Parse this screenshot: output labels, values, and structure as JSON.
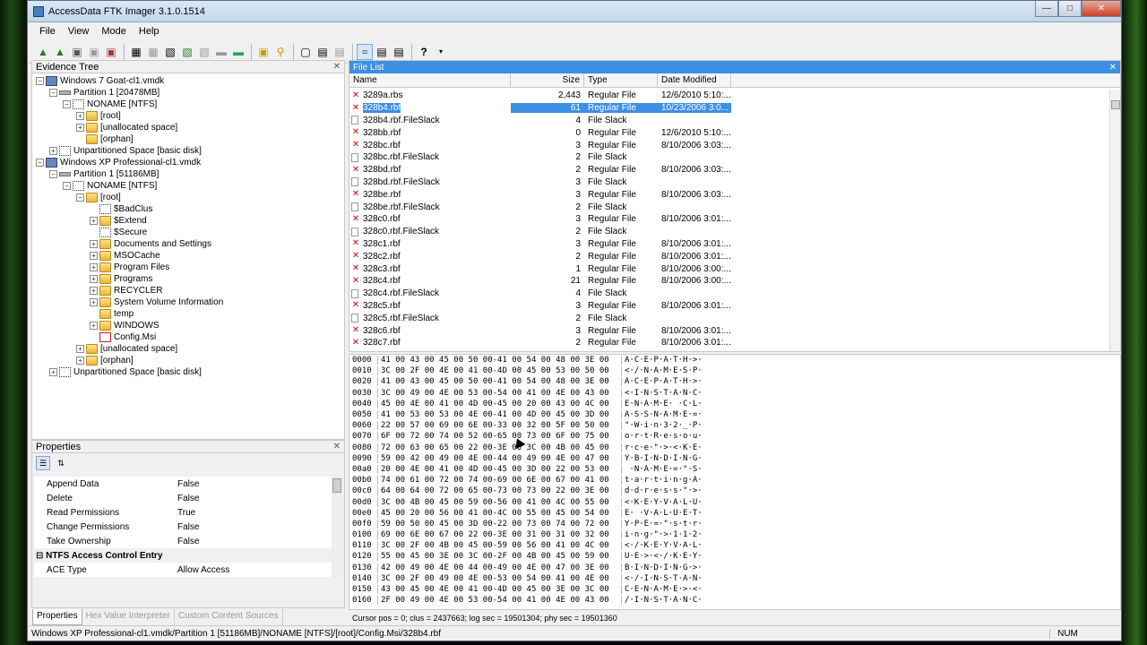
{
  "window": {
    "title": "AccessData FTK Imager 3.1.0.1514"
  },
  "menu": [
    "File",
    "View",
    "Mode",
    "Help"
  ],
  "evidence_tree": {
    "title": "Evidence Tree",
    "nodes": [
      {
        "label": "Windows 7 Goat-cl1.vmdk",
        "indent": 0,
        "icon": "disk",
        "pm": "-"
      },
      {
        "label": "Partition 1 [20478MB]",
        "indent": 1,
        "icon": "part",
        "pm": "-"
      },
      {
        "label": "NONAME [NTFS]",
        "indent": 2,
        "icon": "fs",
        "pm": "-"
      },
      {
        "label": "[root]",
        "indent": 3,
        "icon": "folder",
        "pm": "+"
      },
      {
        "label": "[unallocated space]",
        "indent": 3,
        "icon": "folder",
        "pm": "+"
      },
      {
        "label": "[orphan]",
        "indent": 3,
        "icon": "folder",
        "pm": ""
      },
      {
        "label": "Unpartitioned Space [basic disk]",
        "indent": 1,
        "icon": "fs",
        "pm": "+"
      },
      {
        "label": "Windows XP Professional-cl1.vmdk",
        "indent": 0,
        "icon": "disk",
        "pm": "-"
      },
      {
        "label": "Partition 1 [51186MB]",
        "indent": 1,
        "icon": "part",
        "pm": "-"
      },
      {
        "label": "NONAME [NTFS]",
        "indent": 2,
        "icon": "fs",
        "pm": "-"
      },
      {
        "label": "[root]",
        "indent": 3,
        "icon": "folder",
        "pm": "-"
      },
      {
        "label": "$BadClus",
        "indent": 4,
        "icon": "fs",
        "pm": ""
      },
      {
        "label": "$Extend",
        "indent": 4,
        "icon": "folder",
        "pm": "+"
      },
      {
        "label": "$Secure",
        "indent": 4,
        "icon": "fs",
        "pm": ""
      },
      {
        "label": "Documents and Settings",
        "indent": 4,
        "icon": "folder",
        "pm": "+"
      },
      {
        "label": "MSOCache",
        "indent": 4,
        "icon": "folder",
        "pm": "+"
      },
      {
        "label": "Program Files",
        "indent": 4,
        "icon": "folder",
        "pm": "+"
      },
      {
        "label": "Programs",
        "indent": 4,
        "icon": "folder",
        "pm": "+"
      },
      {
        "label": "RECYCLER",
        "indent": 4,
        "icon": "folder",
        "pm": "+"
      },
      {
        "label": "System Volume Information",
        "indent": 4,
        "icon": "folder",
        "pm": "+"
      },
      {
        "label": "temp",
        "indent": 4,
        "icon": "folder",
        "pm": ""
      },
      {
        "label": "WINDOWS",
        "indent": 4,
        "icon": "folder",
        "pm": "+"
      },
      {
        "label": "Config.Msi",
        "indent": 4,
        "icon": "del",
        "pm": ""
      },
      {
        "label": "[unallocated space]",
        "indent": 3,
        "icon": "folder",
        "pm": "+"
      },
      {
        "label": "[orphan]",
        "indent": 3,
        "icon": "folder",
        "pm": "+"
      },
      {
        "label": "Unpartitioned Space [basic disk]",
        "indent": 1,
        "icon": "fs",
        "pm": "+"
      }
    ]
  },
  "properties": {
    "title": "Properties",
    "rows": [
      {
        "k": "Append Data",
        "v": "False"
      },
      {
        "k": "Delete",
        "v": "False"
      },
      {
        "k": "Read Permissions",
        "v": "True"
      },
      {
        "k": "Change Permissions",
        "v": "False"
      },
      {
        "k": "Take Ownership",
        "v": "False"
      },
      {
        "k": "NTFS Access Control Entry",
        "v": "",
        "cat": true
      },
      {
        "k": "ACE Type",
        "v": "Allow Access"
      }
    ],
    "tabs": [
      "Properties",
      "Hex Value Interpreter",
      "Custom Content Sources"
    ]
  },
  "file_list": {
    "title": "File List",
    "columns": [
      "Name",
      "Size",
      "Type",
      "Date Modified"
    ],
    "rows": [
      {
        "name": "3289a.rbs",
        "size": "2,443",
        "type": "Regular File",
        "date": "12/6/2010 5:10:...",
        "icon": "x"
      },
      {
        "name": "328b4.rbf",
        "size": "61",
        "type": "Regular File",
        "date": "10/23/2006 3:0...",
        "icon": "x",
        "sel": true
      },
      {
        "name": "328b4.rbf.FileSlack",
        "size": "4",
        "type": "File Slack",
        "date": "",
        "icon": "slack"
      },
      {
        "name": "328bb.rbf",
        "size": "0",
        "type": "Regular File",
        "date": "12/6/2010 5:10:...",
        "icon": "x"
      },
      {
        "name": "328bc.rbf",
        "size": "3",
        "type": "Regular File",
        "date": "8/10/2006 3:03:...",
        "icon": "x"
      },
      {
        "name": "328bc.rbf.FileSlack",
        "size": "2",
        "type": "File Slack",
        "date": "",
        "icon": "slack"
      },
      {
        "name": "328bd.rbf",
        "size": "2",
        "type": "Regular File",
        "date": "8/10/2006 3:03:...",
        "icon": "x"
      },
      {
        "name": "328bd.rbf.FileSlack",
        "size": "3",
        "type": "File Slack",
        "date": "",
        "icon": "slack"
      },
      {
        "name": "328be.rbf",
        "size": "3",
        "type": "Regular File",
        "date": "8/10/2006 3:03:...",
        "icon": "x"
      },
      {
        "name": "328be.rbf.FileSlack",
        "size": "2",
        "type": "File Slack",
        "date": "",
        "icon": "slack"
      },
      {
        "name": "328c0.rbf",
        "size": "3",
        "type": "Regular File",
        "date": "8/10/2006 3:01:...",
        "icon": "x"
      },
      {
        "name": "328c0.rbf.FileSlack",
        "size": "2",
        "type": "File Slack",
        "date": "",
        "icon": "slack"
      },
      {
        "name": "328c1.rbf",
        "size": "3",
        "type": "Regular File",
        "date": "8/10/2006 3:01:...",
        "icon": "x"
      },
      {
        "name": "328c2.rbf",
        "size": "2",
        "type": "Regular File",
        "date": "8/10/2006 3:01:...",
        "icon": "x"
      },
      {
        "name": "328c3.rbf",
        "size": "1",
        "type": "Regular File",
        "date": "8/10/2006 3:00:...",
        "icon": "x"
      },
      {
        "name": "328c4.rbf",
        "size": "21",
        "type": "Regular File",
        "date": "8/10/2006 3:00:...",
        "icon": "x"
      },
      {
        "name": "328c4.rbf.FileSlack",
        "size": "4",
        "type": "File Slack",
        "date": "",
        "icon": "slack"
      },
      {
        "name": "328c5.rbf",
        "size": "3",
        "type": "Regular File",
        "date": "8/10/2006 3:01:...",
        "icon": "x"
      },
      {
        "name": "328c5.rbf.FileSlack",
        "size": "2",
        "type": "File Slack",
        "date": "",
        "icon": "slack"
      },
      {
        "name": "328c6.rbf",
        "size": "3",
        "type": "Regular File",
        "date": "8/10/2006 3:01:...",
        "icon": "x"
      },
      {
        "name": "328c7.rbf",
        "size": "2",
        "type": "Regular File",
        "date": "8/10/2006 3:01:...",
        "icon": "x"
      }
    ]
  },
  "hex": {
    "rows": [
      {
        "off": "0000",
        "bytes": "41 00 43 00 45 00 50 00-41 00 54 00 48 00 3E 00",
        "text": "A·C·E·P·A·T·H·>·"
      },
      {
        "off": "0010",
        "bytes": "3C 00 2F 00 4E 00 41 00-4D 00 45 00 53 00 50 00",
        "text": "<·/·N·A·M·E·S·P·"
      },
      {
        "off": "0020",
        "bytes": "41 00 43 00 45 00 50 00-41 00 54 00 48 00 3E 00",
        "text": "A·C·E·P·A·T·H·>·"
      },
      {
        "off": "0030",
        "bytes": "3C 00 49 00 4E 00 53 00-54 00 41 00 4E 00 43 00",
        "text": "<·I·N·S·T·A·N·C·"
      },
      {
        "off": "0040",
        "bytes": "45 00 4E 00 41 00 4D 00-45 00 20 00 43 00 4C 00",
        "text": "E·N·A·M·E· ·C·L·"
      },
      {
        "off": "0050",
        "bytes": "41 00 53 00 53 00 4E 00-41 00 4D 00 45 00 3D 00",
        "text": "A·S·S·N·A·M·E·=·"
      },
      {
        "off": "0060",
        "bytes": "22 00 57 00 69 00 6E 00-33 00 32 00 5F 00 50 00",
        "text": "\"·W·i·n·3·2·_·P·"
      },
      {
        "off": "0070",
        "bytes": "6F 00 72 00 74 00 52 00-65 00 73 00 6F 00 75 00",
        "text": "o·r·t·R·e·s·o·u·"
      },
      {
        "off": "0080",
        "bytes": "72 00 63 00 65 00 22 00-3E 00 3C 00 4B 00 45 00",
        "text": "r·c·e·\"·>·<·K·E·"
      },
      {
        "off": "0090",
        "bytes": "59 00 42 00 49 00 4E 00-44 00 49 00 4E 00 47 00",
        "text": "Y·B·I·N·D·I·N·G·"
      },
      {
        "off": "00a0",
        "bytes": "20 00 4E 00 41 00 4D 00-45 00 3D 00 22 00 53 00",
        "text": " ·N·A·M·E·=·\"·S·"
      },
      {
        "off": "00b0",
        "bytes": "74 00 61 00 72 00 74 00-69 00 6E 00 67 00 41 00",
        "text": "t·a·r·t·i·n·g·A·"
      },
      {
        "off": "00c0",
        "bytes": "64 00 64 00 72 00 65 00-73 00 73 00 22 00 3E 00",
        "text": "d·d·r·e·s·s·\"·>·"
      },
      {
        "off": "00d0",
        "bytes": "3C 00 4B 00 45 00 59 00-56 00 41 00 4C 00 55 00",
        "text": "<·K·E·Y·V·A·L·U·"
      },
      {
        "off": "00e0",
        "bytes": "45 00 20 00 56 00 41 00-4C 00 55 00 45 00 54 00",
        "text": "E· ·V·A·L·U·E·T·"
      },
      {
        "off": "00f0",
        "bytes": "59 00 50 00 45 00 3D 00-22 00 73 00 74 00 72 00",
        "text": "Y·P·E·=·\"·s·t·r·"
      },
      {
        "off": "0100",
        "bytes": "69 00 6E 00 67 00 22 00-3E 00 31 00 31 00 32 00",
        "text": "i·n·g·\"·>·1·1·2·"
      },
      {
        "off": "0110",
        "bytes": "3C 00 2F 00 4B 00 45 00-59 00 56 00 41 00 4C 00",
        "text": "<·/·K·E·Y·V·A·L·"
      },
      {
        "off": "0120",
        "bytes": "55 00 45 00 3E 00 3C 00-2F 00 4B 00 45 00 59 00",
        "text": "U·E·>·<·/·K·E·Y·"
      },
      {
        "off": "0130",
        "bytes": "42 00 49 00 4E 00 44 00-49 00 4E 00 47 00 3E 00",
        "text": "B·I·N·D·I·N·G·>·"
      },
      {
        "off": "0140",
        "bytes": "3C 00 2F 00 49 00 4E 00-53 00 54 00 41 00 4E 00",
        "text": "<·/·I·N·S·T·A·N·"
      },
      {
        "off": "0150",
        "bytes": "43 00 45 00 4E 00 41 00-4D 00 45 00 3E 00 3C 00",
        "text": "C·E·N·A·M·E·>·<·"
      },
      {
        "off": "0160",
        "bytes": "2F 00 49 00 4E 00 53 00-54 00 41 00 4E 00 43 00",
        "text": "/·I·N·S·T·A·N·C·"
      }
    ]
  },
  "status": "Cursor pos = 0; clus = 2437663; log sec = 19501304; phy sec = 19501360",
  "bottom_path": "Windows XP Professional-cl1.vmdk/Partition 1 [51186MB]/NONAME [NTFS]/[root]/Config.Msi/328b4.rbf",
  "num_indicator": "NUM"
}
